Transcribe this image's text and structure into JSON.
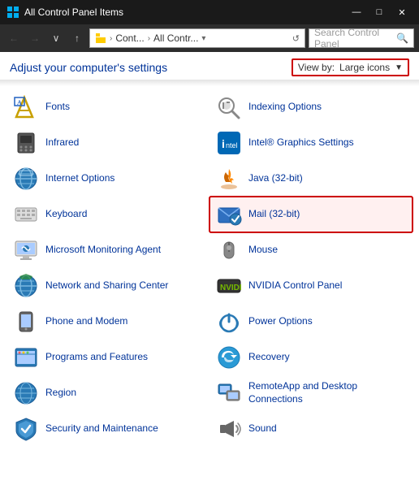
{
  "titleBar": {
    "icon": "⊞",
    "title": "All Control Panel Items",
    "minimizeLabel": "—",
    "restoreLabel": "□",
    "closeLabel": "✕"
  },
  "addressBar": {
    "backLabel": "←",
    "forwardLabel": "→",
    "downLabel": "∨",
    "upLabel": "↑",
    "pathSegments": [
      "Cont...",
      "All Contr..."
    ],
    "dropdownLabel": "∨",
    "refreshLabel": "↺",
    "searchPlaceholder": "Search Control Panel",
    "searchIcon": "🔍"
  },
  "header": {
    "title": "Adjust your computer's settings",
    "viewBy": {
      "label": "View by:",
      "value": "Large icons",
      "arrow": "▼"
    }
  },
  "items": [
    {
      "id": "fonts",
      "label": "Fonts",
      "icon": "fonts",
      "col": 0,
      "highlight": false
    },
    {
      "id": "indexing",
      "label": "Indexing Options",
      "icon": "indexing",
      "col": 1,
      "highlight": false
    },
    {
      "id": "infrared",
      "label": "Infrared",
      "icon": "infrared",
      "col": 0,
      "highlight": false
    },
    {
      "id": "intel",
      "label": "Intel® Graphics Settings",
      "icon": "intel",
      "col": 1,
      "highlight": false
    },
    {
      "id": "internet",
      "label": "Internet Options",
      "icon": "internet",
      "col": 0,
      "highlight": false
    },
    {
      "id": "java",
      "label": "Java (32-bit)",
      "icon": "java",
      "col": 1,
      "highlight": false
    },
    {
      "id": "keyboard",
      "label": "Keyboard",
      "icon": "keyboard",
      "col": 0,
      "highlight": false
    },
    {
      "id": "mail",
      "label": "Mail (32-bit)",
      "icon": "mail",
      "col": 1,
      "highlight": true
    },
    {
      "id": "monitoring",
      "label": "Microsoft Monitoring Agent",
      "icon": "monitoring",
      "col": 0,
      "highlight": false
    },
    {
      "id": "mouse",
      "label": "Mouse",
      "icon": "mouse",
      "col": 1,
      "highlight": false
    },
    {
      "id": "network",
      "label": "Network and Sharing Center",
      "icon": "network",
      "col": 0,
      "highlight": false
    },
    {
      "id": "nvidia",
      "label": "NVIDIA Control Panel",
      "icon": "nvidia",
      "col": 1,
      "highlight": false
    },
    {
      "id": "phone",
      "label": "Phone and Modem",
      "icon": "phone",
      "col": 0,
      "highlight": false
    },
    {
      "id": "power",
      "label": "Power Options",
      "icon": "power",
      "col": 1,
      "highlight": false
    },
    {
      "id": "programs",
      "label": "Programs and Features",
      "icon": "programs",
      "col": 0,
      "highlight": false
    },
    {
      "id": "recovery",
      "label": "Recovery",
      "icon": "recovery",
      "col": 1,
      "highlight": false
    },
    {
      "id": "region",
      "label": "Region",
      "icon": "region",
      "col": 0,
      "highlight": false
    },
    {
      "id": "remote",
      "label": "RemoteApp and Desktop Connections",
      "icon": "remote",
      "col": 1,
      "highlight": false
    },
    {
      "id": "security",
      "label": "Security and Maintenance",
      "icon": "security",
      "col": 0,
      "highlight": false
    },
    {
      "id": "sound",
      "label": "Sound",
      "icon": "sound",
      "col": 1,
      "highlight": false
    }
  ]
}
